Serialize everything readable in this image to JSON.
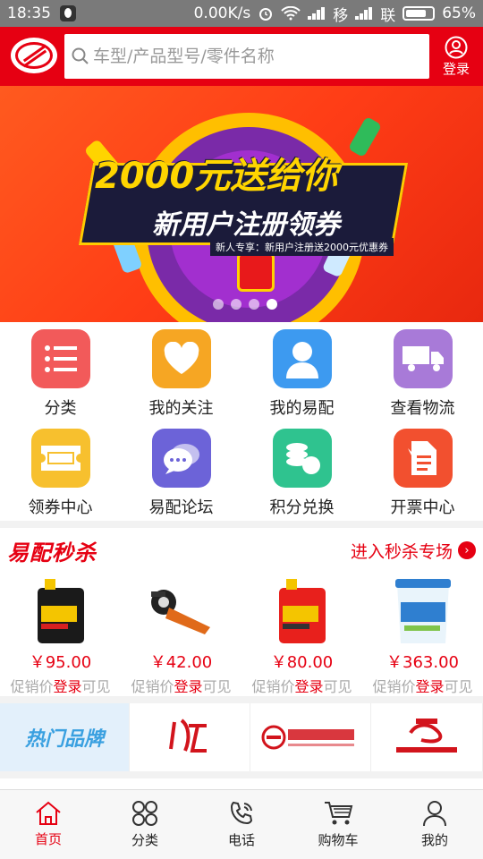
{
  "status_bar": {
    "time": "18:35",
    "net_speed": "0.00K/s",
    "carrier1": "移",
    "carrier2": "联",
    "battery": "65%"
  },
  "header": {
    "search_placeholder": "车型/产品型号/零件名称",
    "login_label": "登录"
  },
  "banner": {
    "headline": "2000元送给你",
    "subheadline": "新用户注册领券",
    "note": "新人专享：新用户注册送2000元优惠券",
    "slides": 4,
    "active_slide": 3
  },
  "shortcuts": [
    {
      "label": "分类",
      "icon": "list-icon",
      "color": "#f25a5a"
    },
    {
      "label": "我的关注",
      "icon": "heart-icon",
      "color": "#f6a623"
    },
    {
      "label": "我的易配",
      "icon": "person-icon",
      "color": "#3d9af0"
    },
    {
      "label": "查看物流",
      "icon": "truck-icon",
      "color": "#a87ad8"
    },
    {
      "label": "领券中心",
      "icon": "ticket-icon",
      "color": "#f7c02e"
    },
    {
      "label": "易配论坛",
      "icon": "chat-icon",
      "color": "#6c63d8"
    },
    {
      "label": "积分兑换",
      "icon": "coins-icon",
      "color": "#2fc38f"
    },
    {
      "label": "开票中心",
      "icon": "invoice-icon",
      "color": "#f2502f"
    }
  ],
  "flash_sale": {
    "title": "易配秒杀",
    "more_label": "进入秒杀专场",
    "products": [
      {
        "price": "￥95.00",
        "note_prefix": "促销价",
        "note_link": "登录",
        "note_suffix": "可见",
        "image": "black-oil-can-image"
      },
      {
        "price": "￥42.00",
        "note_prefix": "促销价",
        "note_link": "登录",
        "note_suffix": "可见",
        "image": "brake-adjuster-image"
      },
      {
        "price": "￥80.00",
        "note_prefix": "促销价",
        "note_link": "登录",
        "note_suffix": "可见",
        "image": "red-oil-can-image"
      },
      {
        "price": "￥363.00",
        "note_prefix": "促销价",
        "note_link": "登录",
        "note_suffix": "可见",
        "image": "blue-bucket-image"
      }
    ]
  },
  "brands": {
    "title": "热门品牌"
  },
  "tabbar": [
    {
      "label": "首页",
      "icon": "home-icon",
      "active": true
    },
    {
      "label": "分类",
      "icon": "grid-icon",
      "active": false
    },
    {
      "label": "电话",
      "icon": "phone-icon",
      "active": false
    },
    {
      "label": "购物车",
      "icon": "cart-icon",
      "active": false
    },
    {
      "label": "我的",
      "icon": "user-icon",
      "active": false
    }
  ]
}
